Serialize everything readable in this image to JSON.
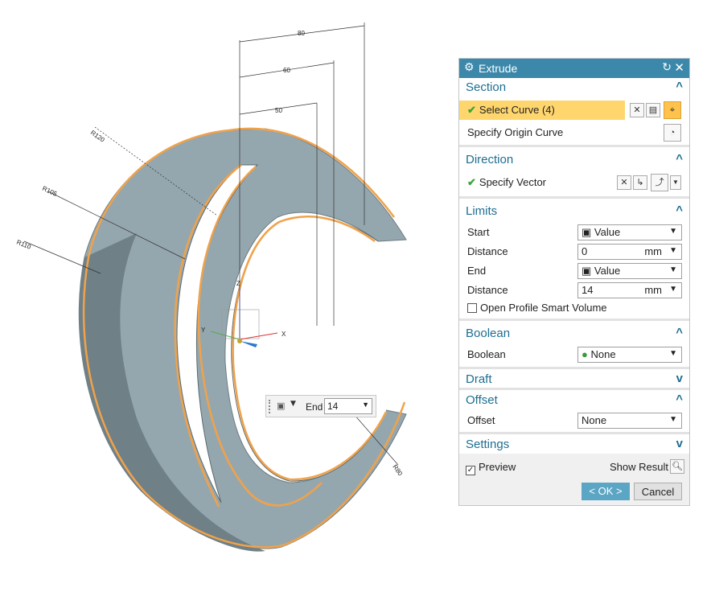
{
  "viewport": {
    "dimensions": [
      "80",
      "60",
      "50"
    ],
    "radii": [
      "R120",
      "R105",
      "R110",
      "R80"
    ],
    "axes": {
      "x": "X",
      "y": "Y",
      "z": "Z"
    },
    "colors": {
      "body": "#95a7ae",
      "highlight": "#f0a24a"
    },
    "mini_toolbar": {
      "label": "End",
      "value": "14"
    }
  },
  "dialog": {
    "title": "Extrude",
    "icons": {
      "title": "gear-icon",
      "reset": "reset-icon",
      "close": "close-icon"
    },
    "accent_color": "#3c88aa",
    "section": {
      "title": "Section",
      "select_curve": "Select Curve (4)",
      "specify_origin_curve": "Specify Origin Curve"
    },
    "direction": {
      "title": "Direction",
      "specify_vector": "Specify Vector"
    },
    "limits": {
      "title": "Limits",
      "start_label": "Start",
      "start_value": "Value",
      "start_distance_label": "Distance",
      "start_distance": "0",
      "start_unit": "mm",
      "end_label": "End",
      "end_value": "Value",
      "end_distance_label": "Distance",
      "end_distance": "14",
      "end_unit": "mm",
      "open_profile": "Open Profile Smart Volume"
    },
    "boolean": {
      "title": "Boolean",
      "label": "Boolean",
      "value": "None"
    },
    "draft": {
      "title": "Draft"
    },
    "offset": {
      "title": "Offset",
      "label": "Offset",
      "value": "None"
    },
    "settings": {
      "title": "Settings"
    },
    "preview": {
      "label": "Preview",
      "checked": true
    },
    "show_result": "Show Result",
    "ok": "< OK >",
    "cancel": "Cancel"
  }
}
